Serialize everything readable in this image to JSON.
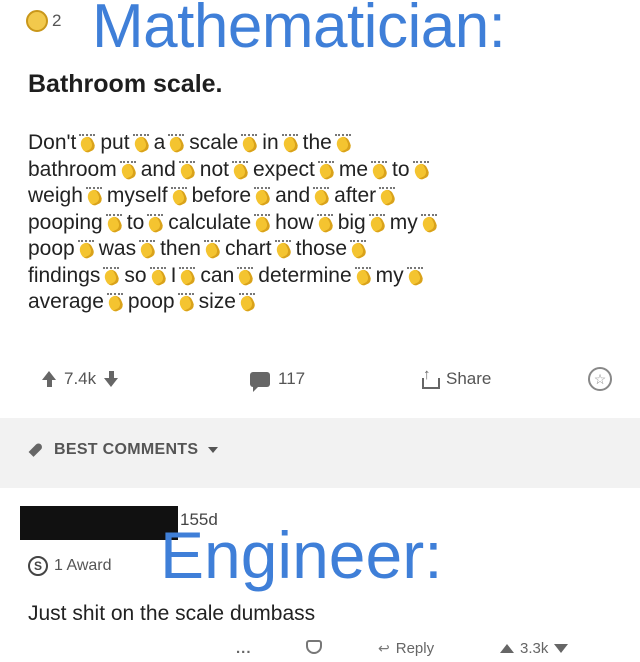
{
  "post": {
    "award_count": "2",
    "overlay_caption": "Mathematician:",
    "title": "Bathroom scale.",
    "body_lines": [
      [
        "Don't",
        "put",
        "a",
        "scale",
        "in",
        "the"
      ],
      [
        "bathroom",
        "and",
        "not",
        "expect",
        "me",
        "to"
      ],
      [
        "weigh",
        "myself",
        "before",
        "and",
        "after"
      ],
      [
        "pooping",
        "to",
        "calculate",
        "how",
        "big",
        "my"
      ],
      [
        "poop",
        "was",
        "then",
        "chart",
        "those"
      ],
      [
        "findings",
        "so",
        "I",
        "can",
        "determine",
        "my"
      ],
      [
        "average",
        "poop",
        "size"
      ]
    ],
    "upvotes": "7.4k",
    "comments": "117",
    "share_label": "Share"
  },
  "section": {
    "best_comments_label": "BEST COMMENTS"
  },
  "comment": {
    "timestamp": "155d",
    "award_label": "1 Award",
    "overlay_caption": "Engineer:",
    "text": "Just shit on the scale dumbass",
    "more_label": "...",
    "reply_label": "Reply",
    "upvotes": "3.3k"
  },
  "colors": {
    "caption_blue": "#3f7fd8",
    "clap_yellow": "#f4c430"
  },
  "icons": {
    "clap": "clapping-hands-icon",
    "upvote": "upvote-arrow-icon",
    "downvote": "downvote-arrow-icon",
    "comment": "comment-bubble-icon",
    "share": "share-icon",
    "save": "save-star-icon",
    "best": "rocket-icon"
  }
}
